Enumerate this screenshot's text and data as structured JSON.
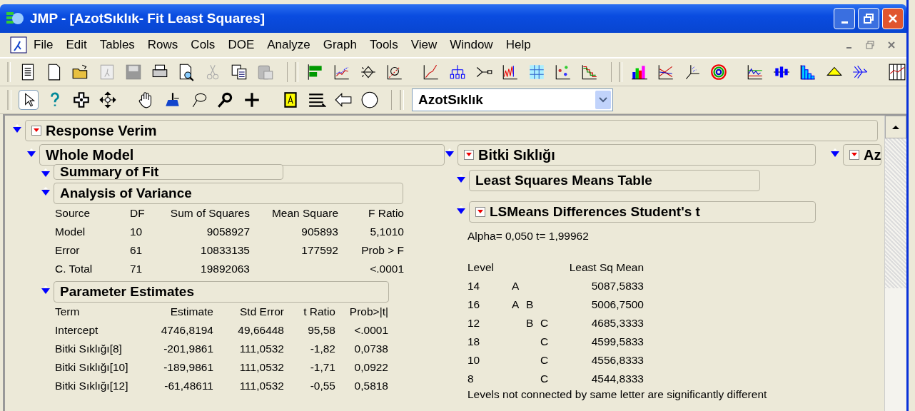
{
  "window": {
    "title": "JMP - [AzotSıklık- Fit Least Squares]"
  },
  "menu": [
    "File",
    "Edit",
    "Tables",
    "Rows",
    "Cols",
    "DOE",
    "Analyze",
    "Graph",
    "Tools",
    "View",
    "Window",
    "Help"
  ],
  "table_selector": {
    "value": "AzotSıklık"
  },
  "report": {
    "title": "Response Verim",
    "menu": true,
    "expanded": true,
    "left": {
      "title": "Whole Model",
      "menu": false,
      "expanded": true,
      "summary": {
        "title": "Summary of Fit",
        "expanded": true
      },
      "anova": {
        "title": "Analysis of Variance",
        "expanded": true,
        "columns": [
          "Source",
          "DF",
          "Sum of Squares",
          "Mean Square",
          "F Ratio"
        ],
        "rows": [
          [
            "Model",
            "10",
            "9058927",
            "905893",
            "5,1010"
          ],
          [
            "Error",
            "61",
            "10833135",
            "177592",
            "Prob > F"
          ],
          [
            "C. Total",
            "71",
            "19892063",
            null,
            "<.0001"
          ]
        ]
      },
      "estimates": {
        "title": "Parameter Estimates",
        "expanded": true,
        "columns": [
          "Term",
          "Estimate",
          "Std Error",
          "t Ratio",
          "Prob>|t|"
        ],
        "rows": [
          [
            "Intercept",
            "4746,8194",
            "49,66448",
            "95,58",
            "<.0001"
          ],
          [
            "Bitki Sıklığı[8]",
            "-201,9861",
            "111,0532",
            "-1,82",
            "0,0738"
          ],
          [
            "Bitki Sıklığı[10]",
            "-189,9861",
            "111,0532",
            "-1,71",
            "0,0922"
          ],
          [
            "Bitki Sıklığı[12]",
            "-61,48611",
            "111,0532",
            "-0,55",
            "0,5818"
          ]
        ]
      }
    },
    "middle": {
      "title": "Bitki Sıklığı",
      "menu": true,
      "expanded": true,
      "means_table": {
        "title": "Least Squares Means Table",
        "expanded": true
      },
      "differences": {
        "title": "LSMeans Differences Student's t",
        "menu": true,
        "expanded": true,
        "alpha": "Alpha= 0,050 t= 1,99962",
        "columns": [
          "Level",
          "Least Sq Mean"
        ],
        "rows": [
          {
            "level": "14",
            "letter_1": "A",
            "mean": "5087,5833"
          },
          {
            "level": "16",
            "letter_1": "A",
            "letter_2": "B",
            "mean": "5006,7500"
          },
          {
            "level": "12",
            "letter_2": "B",
            "letter_3": "C",
            "mean": "4685,3333"
          },
          {
            "level": "18",
            "letter_3": "C",
            "mean": "4599,5833"
          },
          {
            "level": "10",
            "letter_3": "C",
            "mean": "4556,8333"
          },
          {
            "level": "8",
            "letter_3": "C",
            "mean": "4544,8333"
          }
        ],
        "note": "Levels not connected by same letter are significantly different"
      }
    },
    "right": {
      "title": "Az",
      "menu": true,
      "expanded": true
    }
  }
}
